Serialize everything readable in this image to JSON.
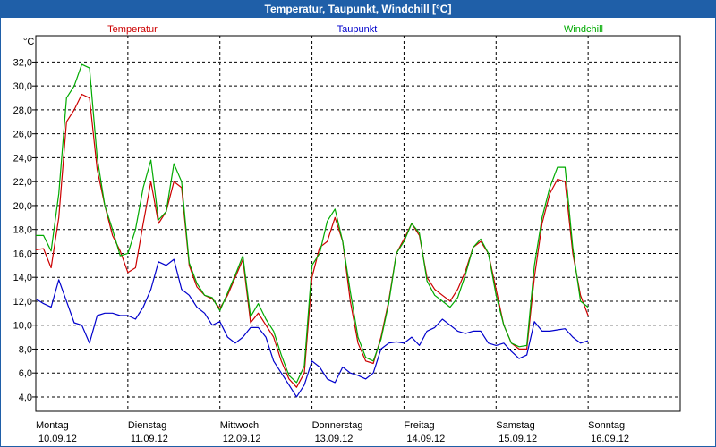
{
  "window": {
    "title": "Temperatur, Taupunkt, Windchill [°C]"
  },
  "colors": {
    "titlebar": "#1f5fa8",
    "temperatur": "#cc0000",
    "taupunkt": "#0000cc",
    "windchill": "#00aa00",
    "grid": "#000000"
  },
  "chart_data": {
    "type": "line",
    "title": "Temperatur, Taupunkt, Windchill [°C]",
    "ylabel": "°C",
    "ylim": [
      2.8,
      34.2
    ],
    "xlim": [
      0,
      168
    ],
    "grid": true,
    "legend_position": "top",
    "y_ticks": [
      {
        "value": 4,
        "label": "4,0"
      },
      {
        "value": 6,
        "label": "6,0"
      },
      {
        "value": 8,
        "label": "8,0"
      },
      {
        "value": 10,
        "label": "10,0"
      },
      {
        "value": 12,
        "label": "12,0"
      },
      {
        "value": 14,
        "label": "14,0"
      },
      {
        "value": 16,
        "label": "16,0"
      },
      {
        "value": 18,
        "label": "18,0"
      },
      {
        "value": 20,
        "label": "20,0"
      },
      {
        "value": 22,
        "label": "22,0"
      },
      {
        "value": 24,
        "label": "24,0"
      },
      {
        "value": 26,
        "label": "26,0"
      },
      {
        "value": 28,
        "label": "28,0"
      },
      {
        "value": 30,
        "label": "30,0"
      },
      {
        "value": 32,
        "label": "32,0"
      }
    ],
    "x_ticks": [
      {
        "value": 0,
        "day": "Montag",
        "date": "10.09.12"
      },
      {
        "value": 24,
        "day": "Dienstag",
        "date": "11.09.12"
      },
      {
        "value": 48,
        "day": "Mittwoch",
        "date": "12.09.12"
      },
      {
        "value": 72,
        "day": "Donnerstag",
        "date": "13.09.12"
      },
      {
        "value": 96,
        "day": "Freitag",
        "date": "14.09.12"
      },
      {
        "value": 120,
        "day": "Samstag",
        "date": "15.09.12"
      },
      {
        "value": 144,
        "day": "Sonntag",
        "date": "16.09.12"
      }
    ],
    "x_gridlines": [
      24,
      48,
      72,
      96,
      120,
      144
    ],
    "series": [
      {
        "name": "Temperatur",
        "color": "#cc0000",
        "points": [
          [
            0,
            16.3
          ],
          [
            2,
            16.4
          ],
          [
            4,
            14.8
          ],
          [
            6,
            19
          ],
          [
            8,
            27
          ],
          [
            10,
            28
          ],
          [
            12,
            29.3
          ],
          [
            14,
            29
          ],
          [
            16,
            23
          ],
          [
            18,
            20
          ],
          [
            20,
            17.5
          ],
          [
            22,
            16.2
          ],
          [
            24,
            14.4
          ],
          [
            26,
            14.8
          ],
          [
            28,
            18.5
          ],
          [
            30,
            22
          ],
          [
            32,
            18.5
          ],
          [
            34,
            19.5
          ],
          [
            36,
            22
          ],
          [
            38,
            21.5
          ],
          [
            40,
            15
          ],
          [
            42,
            13.2
          ],
          [
            44,
            12.5
          ],
          [
            46,
            12.2
          ],
          [
            48,
            11.4
          ],
          [
            50,
            12.5
          ],
          [
            52,
            14
          ],
          [
            54,
            15.5
          ],
          [
            56,
            10.2
          ],
          [
            58,
            11
          ],
          [
            60,
            10
          ],
          [
            62,
            9
          ],
          [
            64,
            7
          ],
          [
            66,
            5.5
          ],
          [
            68,
            4.8
          ],
          [
            70,
            6
          ],
          [
            72,
            14
          ],
          [
            74,
            16.5
          ],
          [
            76,
            17
          ],
          [
            78,
            19
          ],
          [
            80,
            17
          ],
          [
            82,
            12
          ],
          [
            84,
            8.5
          ],
          [
            86,
            7
          ],
          [
            88,
            6.8
          ],
          [
            90,
            9
          ],
          [
            92,
            12
          ],
          [
            94,
            16
          ],
          [
            96,
            17.2
          ],
          [
            98,
            18.5
          ],
          [
            100,
            17.5
          ],
          [
            102,
            14
          ],
          [
            104,
            13
          ],
          [
            106,
            12.5
          ],
          [
            108,
            12
          ],
          [
            110,
            13
          ],
          [
            112,
            14.5
          ],
          [
            114,
            16.5
          ],
          [
            116,
            17
          ],
          [
            118,
            16
          ],
          [
            120,
            13
          ],
          [
            122,
            10
          ],
          [
            124,
            8.5
          ],
          [
            126,
            8
          ],
          [
            128,
            8
          ],
          [
            130,
            14
          ],
          [
            132,
            18.5
          ],
          [
            134,
            21
          ],
          [
            136,
            22.2
          ],
          [
            138,
            22
          ],
          [
            140,
            16
          ],
          [
            142,
            12.5
          ],
          [
            144,
            10.8
          ]
        ]
      },
      {
        "name": "Taupunkt",
        "color": "#0000cc",
        "points": [
          [
            0,
            12.2
          ],
          [
            2,
            11.8
          ],
          [
            4,
            11.5
          ],
          [
            6,
            13.8
          ],
          [
            8,
            12
          ],
          [
            10,
            10.2
          ],
          [
            12,
            10
          ],
          [
            14,
            8.5
          ],
          [
            16,
            10.8
          ],
          [
            18,
            11
          ],
          [
            20,
            11
          ],
          [
            22,
            10.8
          ],
          [
            24,
            10.8
          ],
          [
            26,
            10.5
          ],
          [
            28,
            11.5
          ],
          [
            30,
            13
          ],
          [
            32,
            15.3
          ],
          [
            34,
            15
          ],
          [
            36,
            15.5
          ],
          [
            38,
            13
          ],
          [
            40,
            12.5
          ],
          [
            42,
            11.5
          ],
          [
            44,
            11
          ],
          [
            46,
            10
          ],
          [
            48,
            10.3
          ],
          [
            50,
            9
          ],
          [
            52,
            8.5
          ],
          [
            54,
            9
          ],
          [
            56,
            9.8
          ],
          [
            58,
            9.8
          ],
          [
            60,
            9
          ],
          [
            62,
            7
          ],
          [
            64,
            6
          ],
          [
            66,
            5
          ],
          [
            68,
            4
          ],
          [
            70,
            5
          ],
          [
            72,
            7
          ],
          [
            74,
            6.5
          ],
          [
            76,
            5.5
          ],
          [
            78,
            5.2
          ],
          [
            80,
            6.5
          ],
          [
            82,
            6
          ],
          [
            84,
            5.8
          ],
          [
            86,
            5.5
          ],
          [
            88,
            6
          ],
          [
            90,
            8
          ],
          [
            92,
            8.5
          ],
          [
            94,
            8.6
          ],
          [
            96,
            8.5
          ],
          [
            98,
            9
          ],
          [
            100,
            8.3
          ],
          [
            102,
            9.5
          ],
          [
            104,
            9.8
          ],
          [
            106,
            10.5
          ],
          [
            108,
            10
          ],
          [
            110,
            9.5
          ],
          [
            112,
            9.3
          ],
          [
            114,
            9.5
          ],
          [
            116,
            9.5
          ],
          [
            118,
            8.5
          ],
          [
            120,
            8.3
          ],
          [
            122,
            8.5
          ],
          [
            124,
            7.8
          ],
          [
            126,
            7.2
          ],
          [
            128,
            7.5
          ],
          [
            130,
            10.3
          ],
          [
            132,
            9.5
          ],
          [
            134,
            9.5
          ],
          [
            136,
            9.6
          ],
          [
            138,
            9.7
          ],
          [
            140,
            9
          ],
          [
            142,
            8.5
          ],
          [
            144,
            8.7
          ]
        ]
      },
      {
        "name": "Windchill",
        "color": "#00aa00",
        "points": [
          [
            0,
            17.5
          ],
          [
            2,
            17.5
          ],
          [
            4,
            16.2
          ],
          [
            6,
            21
          ],
          [
            8,
            29
          ],
          [
            10,
            30
          ],
          [
            12,
            31.8
          ],
          [
            14,
            31.5
          ],
          [
            16,
            24
          ],
          [
            18,
            20
          ],
          [
            20,
            18
          ],
          [
            22,
            15.8
          ],
          [
            24,
            16
          ],
          [
            26,
            18
          ],
          [
            28,
            21.5
          ],
          [
            30,
            23.8
          ],
          [
            32,
            18.8
          ],
          [
            34,
            19.5
          ],
          [
            36,
            23.5
          ],
          [
            38,
            22
          ],
          [
            40,
            15.2
          ],
          [
            42,
            13.5
          ],
          [
            44,
            12.5
          ],
          [
            46,
            12.3
          ],
          [
            48,
            11.2
          ],
          [
            50,
            12.7
          ],
          [
            52,
            14.2
          ],
          [
            54,
            15.8
          ],
          [
            56,
            10.7
          ],
          [
            58,
            11.8
          ],
          [
            60,
            10.5
          ],
          [
            62,
            9.5
          ],
          [
            64,
            7.5
          ],
          [
            66,
            5.8
          ],
          [
            68,
            5.2
          ],
          [
            70,
            6.6
          ],
          [
            72,
            15
          ],
          [
            74,
            16
          ],
          [
            76,
            18.7
          ],
          [
            78,
            19.7
          ],
          [
            80,
            17
          ],
          [
            82,
            12.8
          ],
          [
            84,
            9
          ],
          [
            86,
            7.3
          ],
          [
            88,
            7
          ],
          [
            90,
            8.8
          ],
          [
            92,
            11.8
          ],
          [
            94,
            16
          ],
          [
            96,
            17
          ],
          [
            98,
            18.5
          ],
          [
            100,
            17.7
          ],
          [
            102,
            13.7
          ],
          [
            104,
            12.5
          ],
          [
            106,
            12
          ],
          [
            108,
            11.5
          ],
          [
            110,
            12.3
          ],
          [
            112,
            14.2
          ],
          [
            114,
            16.5
          ],
          [
            116,
            17.2
          ],
          [
            118,
            16
          ],
          [
            120,
            12.5
          ],
          [
            122,
            10
          ],
          [
            124,
            8.5
          ],
          [
            126,
            8.2
          ],
          [
            128,
            8.3
          ],
          [
            130,
            15
          ],
          [
            132,
            19
          ],
          [
            134,
            21.5
          ],
          [
            136,
            23.2
          ],
          [
            138,
            23.2
          ],
          [
            140,
            16.5
          ],
          [
            142,
            12
          ],
          [
            144,
            11.5
          ]
        ]
      }
    ]
  }
}
